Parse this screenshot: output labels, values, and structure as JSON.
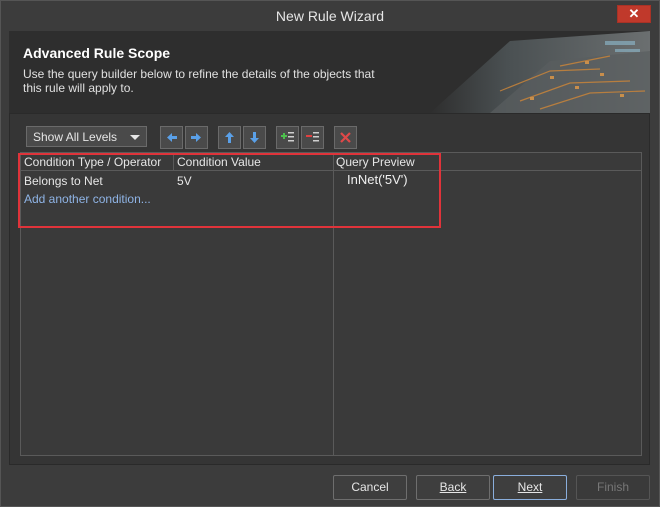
{
  "window": {
    "title": "New Rule Wizard",
    "close_label": "✕"
  },
  "banner": {
    "heading": "Advanced Rule Scope",
    "description": "Use the query builder below to refine the details of the objects that this rule will apply to."
  },
  "toolbar": {
    "levels_select": "Show All Levels",
    "buttons": [
      "arrow-left-icon",
      "arrow-right-icon",
      "arrow-up-icon",
      "arrow-down-icon",
      "add-condition-icon",
      "remove-condition-icon",
      "delete-icon"
    ]
  },
  "grid": {
    "headers": {
      "type": "Condition Type / Operator",
      "value": "Condition Value",
      "preview": "Query Preview"
    },
    "rows": [
      {
        "type": "Belongs to Net",
        "value": "5V"
      }
    ],
    "add_link": "Add another condition...",
    "query_preview": "InNet('5V')"
  },
  "footer": {
    "cancel": "Cancel",
    "back": "Back",
    "next": "Next",
    "finish": "Finish"
  },
  "colors": {
    "highlight": "#e0333a",
    "accent": "#4a8fe0",
    "close": "#c0392b"
  }
}
